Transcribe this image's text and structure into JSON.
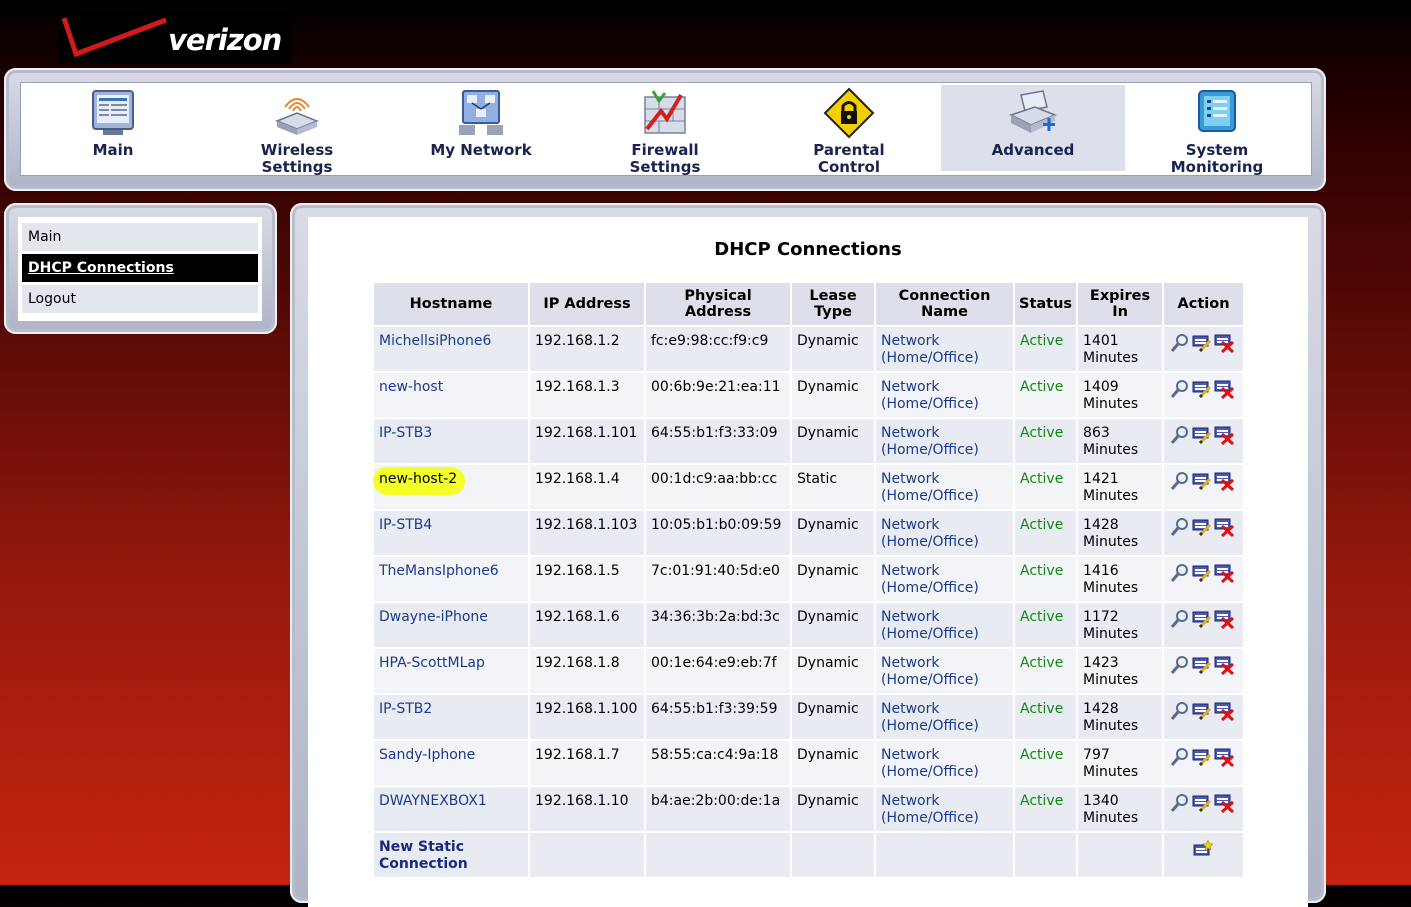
{
  "brand": {
    "logo_text": "verizon",
    "logo_name": "verizon-logo"
  },
  "nav": {
    "tabs": [
      {
        "id": "main",
        "label_line1": "Main",
        "label_line2": "",
        "icon": "main-monitor-icon",
        "active": false
      },
      {
        "id": "wireless",
        "label_line1": "Wireless",
        "label_line2": "Settings",
        "icon": "wireless-router-icon",
        "active": false
      },
      {
        "id": "mynetwork",
        "label_line1": "My Network",
        "label_line2": "",
        "icon": "my-network-icon",
        "active": false
      },
      {
        "id": "firewall",
        "label_line1": "Firewall",
        "label_line2": "Settings",
        "icon": "firewall-icon",
        "active": false
      },
      {
        "id": "parental",
        "label_line1": "Parental",
        "label_line2": "Control",
        "icon": "padlock-icon",
        "active": false
      },
      {
        "id": "advanced",
        "label_line1": "Advanced",
        "label_line2": "",
        "icon": "advanced-scanner-icon",
        "active": true
      },
      {
        "id": "system",
        "label_line1": "System",
        "label_line2": "Monitoring",
        "icon": "system-monitoring-icon",
        "active": false
      }
    ]
  },
  "sidebar": {
    "items": [
      {
        "label": "Main",
        "selected": false
      },
      {
        "label": "DHCP Connections",
        "selected": true
      },
      {
        "label": "Logout",
        "selected": false
      }
    ]
  },
  "main": {
    "title": "DHCP Connections",
    "columns": [
      {
        "line1": "Hostname",
        "line2": ""
      },
      {
        "line1": "IP Address",
        "line2": ""
      },
      {
        "line1": "Physical Address",
        "line2": ""
      },
      {
        "line1": "Lease",
        "line2": "Type"
      },
      {
        "line1": "Connection",
        "line2": "Name"
      },
      {
        "line1": "Status",
        "line2": ""
      },
      {
        "line1": "Expires",
        "line2": "In"
      },
      {
        "line1": "Action",
        "line2": ""
      }
    ],
    "rows": [
      {
        "hostname": "MichellsiPhone6",
        "ip": "192.168.1.2",
        "mac": "fc:e9:98:cc:f9:c9",
        "lease": "Dynamic",
        "conn1": "Network",
        "conn2": "(Home/Office)",
        "status": "Active",
        "exp1": "1401",
        "exp2": "Minutes"
      },
      {
        "hostname": "new-host",
        "ip": "192.168.1.3",
        "mac": "00:6b:9e:21:ea:11",
        "lease": "Dynamic",
        "conn1": "Network",
        "conn2": "(Home/Office)",
        "status": "Active",
        "exp1": "1409",
        "exp2": "Minutes"
      },
      {
        "hostname": "IP-STB3",
        "ip": "192.168.1.101",
        "mac": "64:55:b1:f3:33:09",
        "lease": "Dynamic",
        "conn1": "Network",
        "conn2": "(Home/Office)",
        "status": "Active",
        "exp1": "863",
        "exp2": "Minutes"
      },
      {
        "hostname": "new-host-2",
        "ip": "192.168.1.4",
        "mac": "00:1d:c9:aa:bb:cc",
        "lease": "Static",
        "conn1": "Network",
        "conn2": "(Home/Office)",
        "status": "Active",
        "exp1": "1421",
        "exp2": "Minutes"
      },
      {
        "hostname": "IP-STB4",
        "ip": "192.168.1.103",
        "mac": "10:05:b1:b0:09:59",
        "lease": "Dynamic",
        "conn1": "Network",
        "conn2": "(Home/Office)",
        "status": "Active",
        "exp1": "1428",
        "exp2": "Minutes"
      },
      {
        "hostname": "TheMansIphone6",
        "ip": "192.168.1.5",
        "mac": "7c:01:91:40:5d:e0",
        "lease": "Dynamic",
        "conn1": "Network",
        "conn2": "(Home/Office)",
        "status": "Active",
        "exp1": "1416",
        "exp2": "Minutes"
      },
      {
        "hostname": "Dwayne-iPhone",
        "ip": "192.168.1.6",
        "mac": "34:36:3b:2a:bd:3c",
        "lease": "Dynamic",
        "conn1": "Network",
        "conn2": "(Home/Office)",
        "status": "Active",
        "exp1": "1172",
        "exp2": "Minutes"
      },
      {
        "hostname": "HPA-ScottMLap",
        "ip": "192.168.1.8",
        "mac": "00:1e:64:e9:eb:7f",
        "lease": "Dynamic",
        "conn1": "Network",
        "conn2": "(Home/Office)",
        "status": "Active",
        "exp1": "1423",
        "exp2": "Minutes"
      },
      {
        "hostname": "IP-STB2",
        "ip": "192.168.1.100",
        "mac": "64:55:b1:f3:39:59",
        "lease": "Dynamic",
        "conn1": "Network",
        "conn2": "(Home/Office)",
        "status": "Active",
        "exp1": "1428",
        "exp2": "Minutes"
      },
      {
        "hostname": "Sandy-Iphone",
        "ip": "192.168.1.7",
        "mac": "58:55:ca:c4:9a:18",
        "lease": "Dynamic",
        "conn1": "Network",
        "conn2": "(Home/Office)",
        "status": "Active",
        "exp1": "797",
        "exp2": "Minutes"
      },
      {
        "hostname": "DWAYNEXBOX1",
        "ip": "192.168.1.10",
        "mac": "b4:ae:2b:00:de:1a",
        "lease": "Dynamic",
        "conn1": "Network",
        "conn2": "(Home/Office)",
        "status": "Active",
        "exp1": "1340",
        "exp2": "Minutes"
      }
    ],
    "highlighted_hostname": "new-host-2",
    "new_static": {
      "line1": "New Static",
      "line2": "Connection"
    },
    "action_icons": [
      "view-details-icon",
      "edit-icon",
      "delete-icon"
    ]
  },
  "colors": {
    "active_status": "#108a10",
    "link": "#1a3a8a",
    "highlight": "#f4ff2a"
  }
}
